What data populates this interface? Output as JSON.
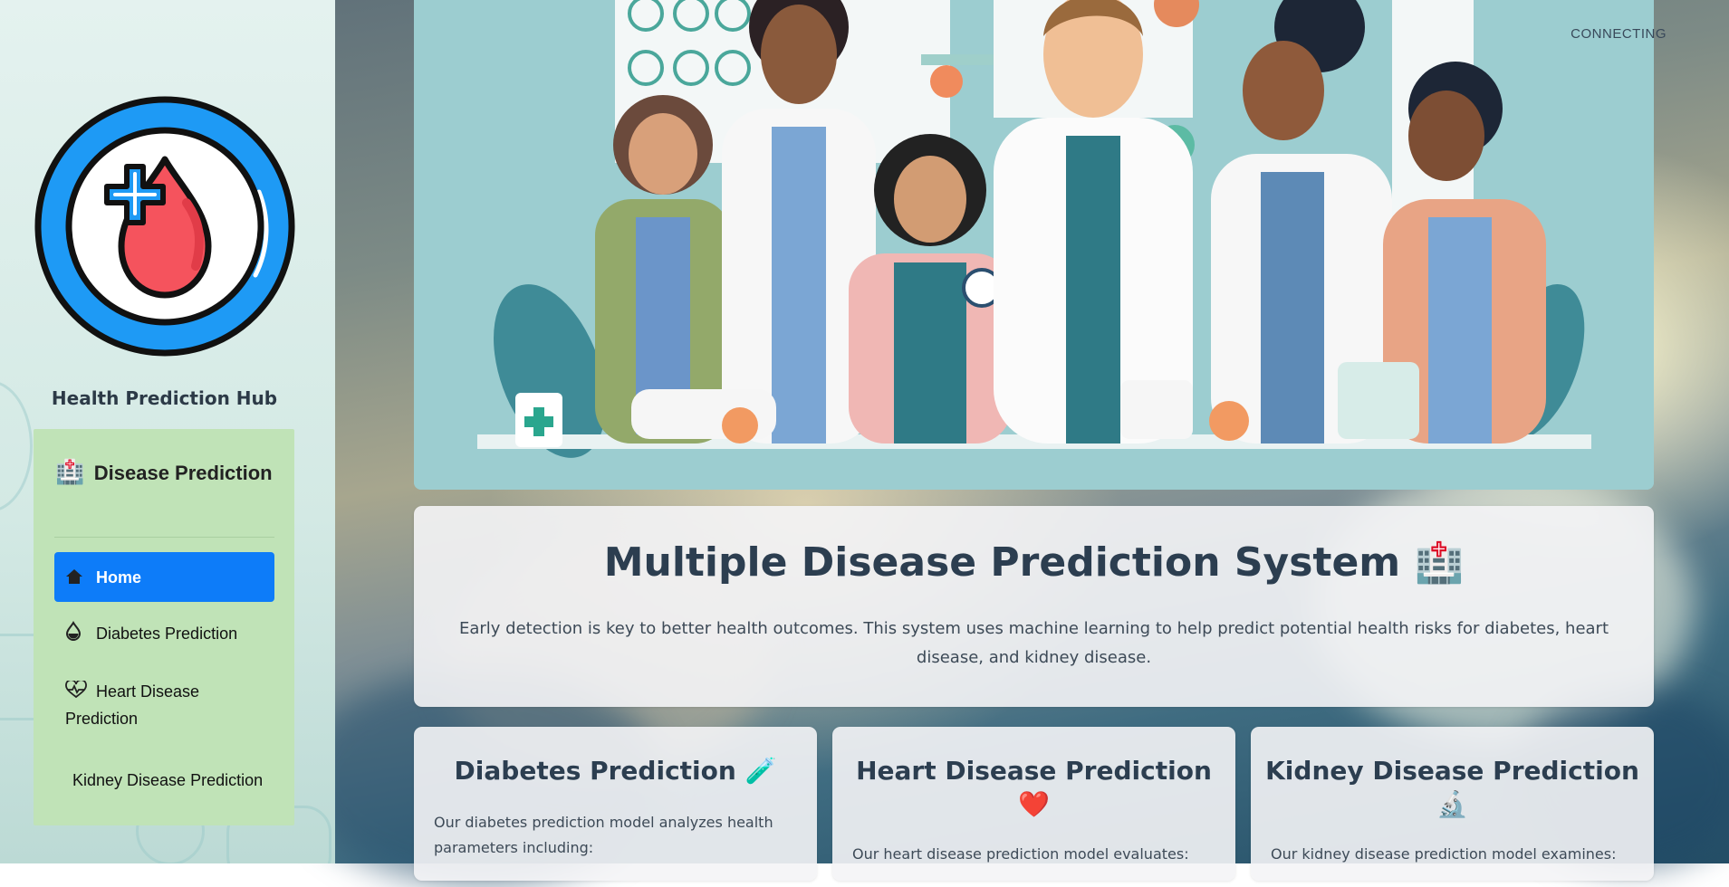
{
  "status": "CONNECTING",
  "sidebar": {
    "hub_title": "Health Prediction Hub",
    "menu_title": "Disease Prediction",
    "items": [
      {
        "label": "Home",
        "icon": "house-icon",
        "active": true
      },
      {
        "label": "Diabetes Prediction",
        "icon": "droplet-icon",
        "active": false
      },
      {
        "label": "Heart Disease Prediction",
        "icon": "heart-pulse-icon",
        "active": false
      },
      {
        "label": "Kidney Disease Prediction",
        "icon": "",
        "active": false
      }
    ]
  },
  "main": {
    "title": "Multiple Disease Prediction System",
    "title_icon": "hospital-icon",
    "description": "Early detection is key to better health outcomes. This system uses machine learning to help predict potential health risks for diabetes, heart disease, and kidney disease."
  },
  "cards": [
    {
      "title": "Diabetes Prediction",
      "icon": "test-tube-icon",
      "text": "Our diabetes prediction model analyzes health parameters including:"
    },
    {
      "title": "Heart Disease Prediction",
      "icon": "heart-icon",
      "text": "Our heart disease prediction model evaluates:"
    },
    {
      "title": "Kidney Disease Prediction",
      "icon": "microscope-icon",
      "text": "Our kidney disease prediction model examines:"
    }
  ],
  "colors": {
    "active_menu": "#0d7cf9",
    "menu_card": "#c0e3b7",
    "logo_blue": "#1e9af5",
    "logo_drop": "#f5535d",
    "title_text": "#2c3e50"
  }
}
